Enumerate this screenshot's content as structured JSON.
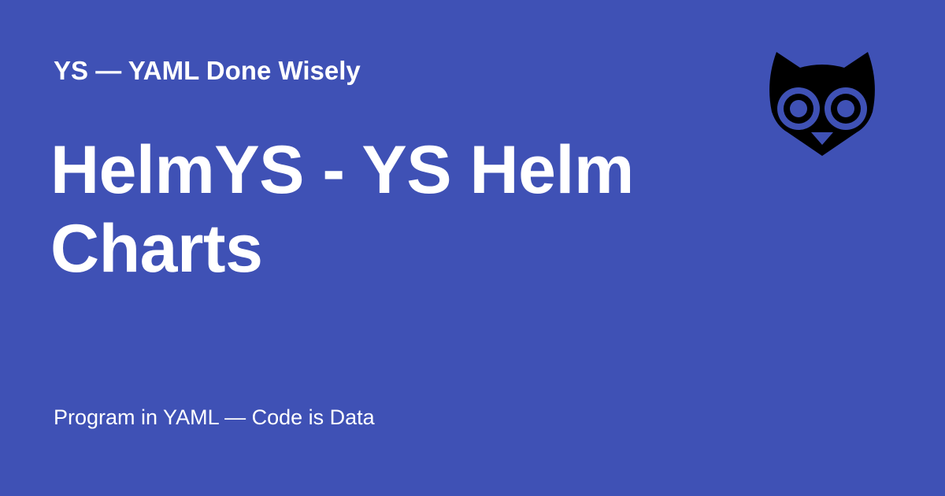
{
  "card": {
    "background_color": "#3f51b5",
    "text_color": "#ffffff",
    "site_name": "YS — YAML Done Wisely",
    "title": "HelmYS - YS Helm Charts",
    "tagline": "Program in YAML — Code is Data",
    "logo": {
      "icon": "owl-icon",
      "color": "#000000"
    }
  }
}
